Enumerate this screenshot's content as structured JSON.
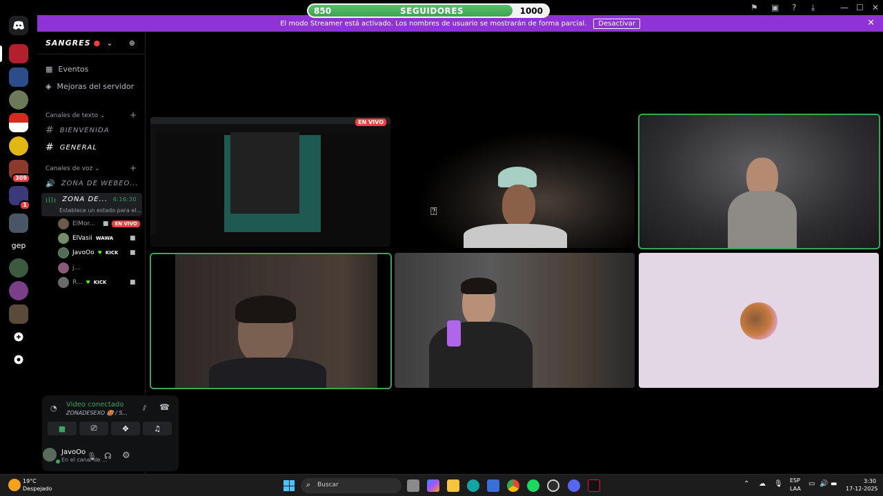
{
  "followers": {
    "current": "850",
    "label": "SEGUIDORES",
    "goal": "1000",
    "progress": 0.85
  },
  "streamer_mode": {
    "text": "El modo Streamer está activado. Los nombres de usuario se mostrarán de forma parcial.",
    "button": "Desactivar"
  },
  "server": {
    "name": "SANGRES"
  },
  "sidebar": {
    "events": "Eventos",
    "boosts": "Mejoras del servidor",
    "text_category": "Canales de texto",
    "text_channels": [
      "BIENVENIDA",
      "GENERAL"
    ],
    "voice_category": "Canales de voz",
    "voice_channels": [
      {
        "name": "ZONA DE WEBEO...",
        "active": false
      },
      {
        "name": "ZONA DE...",
        "timer": "4:16:30",
        "status": "Establece un estado para el...",
        "active": true
      }
    ],
    "voice_users": [
      {
        "name": "ElMor...",
        "tag": "EN VIVO"
      },
      {
        "name": "ElVasii",
        "tag": "WAWA"
      },
      {
        "name": "JavoOo",
        "tag": "KICK"
      },
      {
        "name": "j...",
        "tag": ""
      },
      {
        "name": "R...",
        "tag": "KICK"
      }
    ]
  },
  "voice_panel": {
    "status": "Video conectado",
    "channel": "ZONADESEXO 🥵 / S..."
  },
  "user": {
    "name": "JavoOo",
    "status": "En el canal de ..."
  },
  "rail_badges": [
    "309",
    "1"
  ],
  "rail_text_server": "gep",
  "stream_tile": {
    "live": "EN VIVO"
  },
  "taskbar": {
    "weather_temp": "19°C",
    "weather_desc": "Despejado",
    "search": "Buscar",
    "lang": "ESP",
    "lang2": "LAA",
    "time": "3:30",
    "date": "17-12-2025"
  },
  "colors": {
    "accent_green": "#3ba55c",
    "streamer_purple": "#8f33d6",
    "live_red": "#f23f43"
  }
}
